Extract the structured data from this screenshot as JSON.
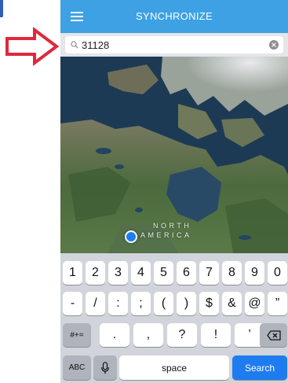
{
  "app": {
    "title": "SYNCHRONIZE",
    "accent_color": "#3da1e3"
  },
  "search": {
    "value": "31128",
    "placeholder": ""
  },
  "map": {
    "region_line1": "NORTH",
    "region_line2": "AMERICA"
  },
  "keyboard": {
    "row1": [
      "1",
      "2",
      "3",
      "4",
      "5",
      "6",
      "7",
      "8",
      "9",
      "0"
    ],
    "row2": [
      "-",
      "/",
      ":",
      ";",
      "(",
      ")",
      "$",
      "&",
      "@",
      "”"
    ],
    "row3_mode": "#+=",
    "row3": [
      ".",
      ",",
      "?",
      "!",
      "’"
    ],
    "abc": "ABC",
    "space": "space",
    "search": "Search"
  },
  "icons": {
    "menu": "hamburger-menu-icon",
    "search": "magnifier-icon",
    "clear": "clear-x-icon",
    "mic": "microphone-icon",
    "backspace": "backspace-icon",
    "pointer": "red-arrow-icon"
  }
}
